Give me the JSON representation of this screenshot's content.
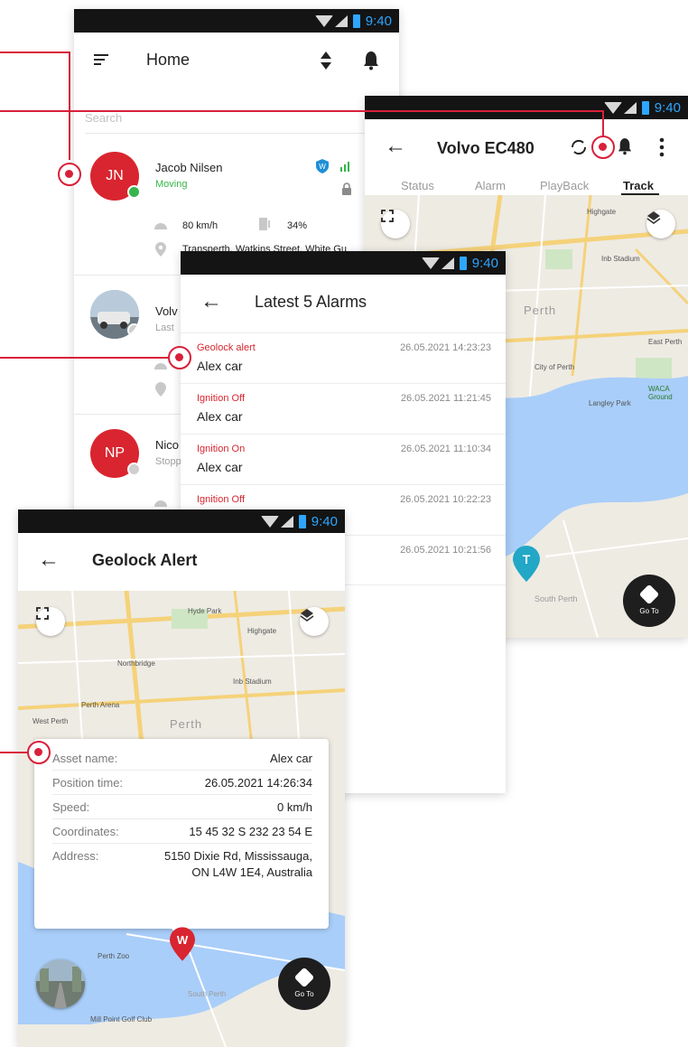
{
  "status_time": "9:40",
  "colors": {
    "brand_red": "#d9252f",
    "callout_red": "#d9203a",
    "online_green": "#35b54a"
  },
  "home": {
    "title": "Home",
    "search_placeholder": "Search",
    "items": [
      {
        "initials": "JN",
        "name": "Jacob Nilsen",
        "status": "Moving",
        "speed": "80 km/h",
        "fuel": "34%",
        "address": "Transperth, Watkins Street, White Gu"
      },
      {
        "initials": "",
        "name": "Volv",
        "status": "Last"
      },
      {
        "initials": "NP",
        "name": "Nico",
        "status": "Stopp"
      }
    ]
  },
  "track": {
    "title": "Volvo EC480",
    "tabs": [
      "Status",
      "Alarm",
      "PlayBack",
      "Track"
    ],
    "active_tab": "Track",
    "goto_label": "Go To",
    "marker_label": "T",
    "map_labels": [
      "Perth",
      "City of Perth",
      "Langley Park",
      "East Perth",
      "WACA Ground",
      "Highgate",
      "Inb Stadium",
      "South Perth"
    ]
  },
  "alarms": {
    "title": "Latest 5 Alarms",
    "items": [
      {
        "type": "Geolock alert",
        "asset": "Alex car",
        "date": "26.05.2021 14:23:23"
      },
      {
        "type": "Ignition Off",
        "asset": "Alex car",
        "date": "26.05.2021 11:21:45"
      },
      {
        "type": "Ignition On",
        "asset": "Alex car",
        "date": "26.05.2021 11:10:34"
      },
      {
        "type": "Ignition Off",
        "asset": "",
        "date": "26.05.2021 10:22:23"
      },
      {
        "type": "",
        "asset": "",
        "date": "26.05.2021 10:21:56"
      }
    ]
  },
  "geolock": {
    "title": "Geolock Alert",
    "goto_label": "Go To",
    "marker_label": "W",
    "map_labels": [
      "Perth",
      "Hyde Park",
      "Highgate",
      "Northbridge",
      "Perth Arena",
      "Inb Stadium",
      "West Perth",
      "Perth Zoo",
      "South Perth",
      "Mill Point Golf Club"
    ],
    "details": [
      {
        "key": "Asset name:",
        "value": "Alex car"
      },
      {
        "key": "Position time:",
        "value": "26.05.2021 14:26:34"
      },
      {
        "key": "Speed:",
        "value": "0 km/h"
      },
      {
        "key": "Coordinates:",
        "value": "15 45 32 S 232 23 54 E"
      },
      {
        "key": "Address:",
        "value": "5150 Dixie Rd, Mississauga,"
      },
      {
        "key": "",
        "value": "ON L4W 1E4, Australia"
      }
    ]
  }
}
